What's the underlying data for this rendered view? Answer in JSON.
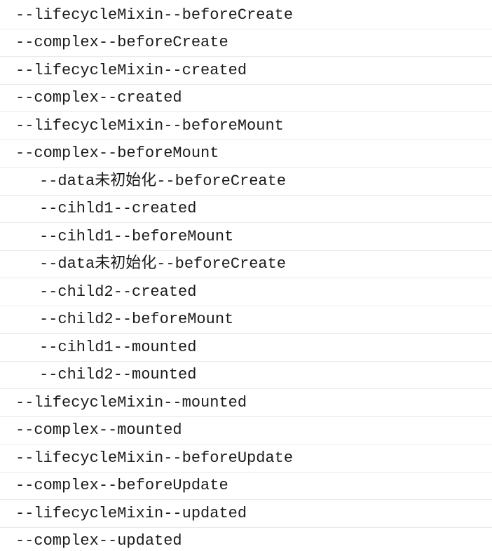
{
  "logs": [
    {
      "indent": 0,
      "text": "--lifecycleMixin--beforeCreate"
    },
    {
      "indent": 0,
      "text": "--complex--beforeCreate"
    },
    {
      "indent": 0,
      "text": "--lifecycleMixin--created"
    },
    {
      "indent": 0,
      "text": "--complex--created"
    },
    {
      "indent": 0,
      "text": "--lifecycleMixin--beforeMount"
    },
    {
      "indent": 0,
      "text": "--complex--beforeMount"
    },
    {
      "indent": 1,
      "text": "--data未初始化--beforeCreate"
    },
    {
      "indent": 1,
      "text": "--cihld1--created"
    },
    {
      "indent": 1,
      "text": "--cihld1--beforeMount"
    },
    {
      "indent": 1,
      "text": "--data未初始化--beforeCreate"
    },
    {
      "indent": 1,
      "text": "--child2--created"
    },
    {
      "indent": 1,
      "text": "--child2--beforeMount"
    },
    {
      "indent": 1,
      "text": "--cihld1--mounted"
    },
    {
      "indent": 1,
      "text": "--child2--mounted"
    },
    {
      "indent": 0,
      "text": "--lifecycleMixin--mounted"
    },
    {
      "indent": 0,
      "text": "--complex--mounted"
    },
    {
      "indent": 0,
      "text": "--lifecycleMixin--beforeUpdate"
    },
    {
      "indent": 0,
      "text": "--complex--beforeUpdate"
    },
    {
      "indent": 0,
      "text": "--lifecycleMixin--updated"
    },
    {
      "indent": 0,
      "text": "--complex--updated"
    }
  ]
}
